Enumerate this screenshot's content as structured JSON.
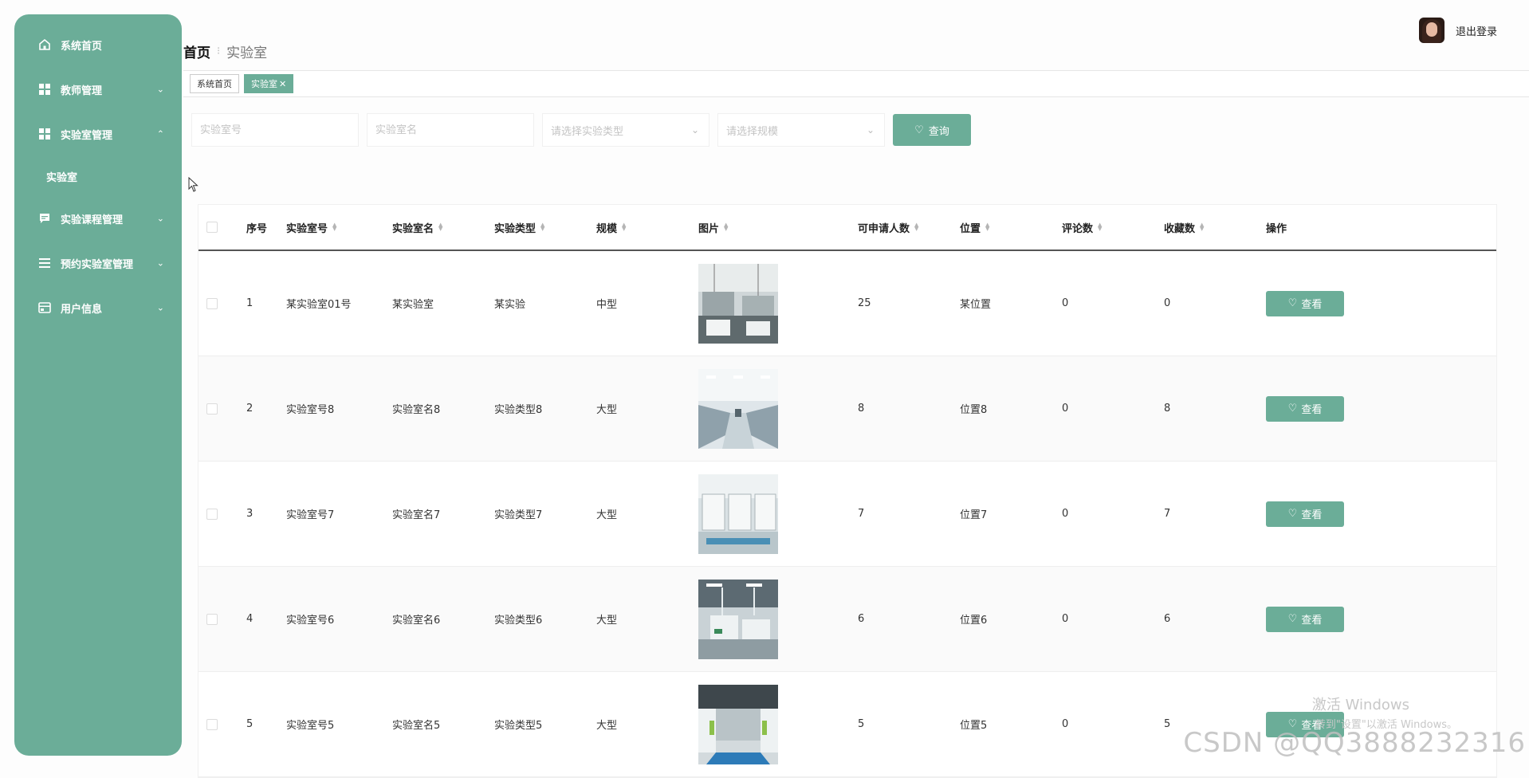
{
  "sidebar": {
    "items": [
      {
        "label": "系统首页",
        "icon": "home-icon"
      },
      {
        "label": "教师管理",
        "icon": "grid-icon"
      },
      {
        "label": "实验室管理",
        "icon": "grid-icon",
        "sub": "实验室"
      },
      {
        "label": "实验课程管理",
        "icon": "chat-icon"
      },
      {
        "label": "预约实验室管理",
        "icon": "list-icon"
      },
      {
        "label": "用户信息",
        "icon": "card-icon"
      }
    ]
  },
  "header": {
    "logout": "退出登录"
  },
  "breadcrumb": {
    "home": "首页",
    "current": "实验室"
  },
  "tags": {
    "home": "系统首页",
    "active": "实验室"
  },
  "search": {
    "no_placeholder": "实验室号",
    "name_placeholder": "实验室名",
    "type_placeholder": "请选择实验类型",
    "scale_placeholder": "请选择规模",
    "button": "查询"
  },
  "table": {
    "headers": [
      "序号",
      "实验室号",
      "实验室名",
      "实验类型",
      "规模",
      "图片",
      "可申请人数",
      "位置",
      "评论数",
      "收藏数",
      "操作"
    ],
    "rows": [
      {
        "idx": "1",
        "no": "某实验室01号",
        "name": "某实验室",
        "type": "某实验",
        "scale": "中型",
        "cap": "25",
        "loc": "某位置",
        "cmt": "0",
        "fav": "0"
      },
      {
        "idx": "2",
        "no": "实验室号8",
        "name": "实验室名8",
        "type": "实验类型8",
        "scale": "大型",
        "cap": "8",
        "loc": "位置8",
        "cmt": "0",
        "fav": "8"
      },
      {
        "idx": "3",
        "no": "实验室号7",
        "name": "实验室名7",
        "type": "实验类型7",
        "scale": "大型",
        "cap": "7",
        "loc": "位置7",
        "cmt": "0",
        "fav": "7"
      },
      {
        "idx": "4",
        "no": "实验室号6",
        "name": "实验室名6",
        "type": "实验类型6",
        "scale": "大型",
        "cap": "6",
        "loc": "位置6",
        "cmt": "0",
        "fav": "6"
      },
      {
        "idx": "5",
        "no": "实验室号5",
        "name": "实验室名5",
        "type": "实验类型5",
        "scale": "大型",
        "cap": "5",
        "loc": "位置5",
        "cmt": "0",
        "fav": "5"
      }
    ],
    "view_label": "查看"
  },
  "watermarks": {
    "activate_title": "激活 Windows",
    "activate_sub": "转到\"设置\"以激活 Windows。",
    "csdn": "CSDN @QQ3888232316"
  },
  "colors": {
    "accent": "#6bad98"
  }
}
